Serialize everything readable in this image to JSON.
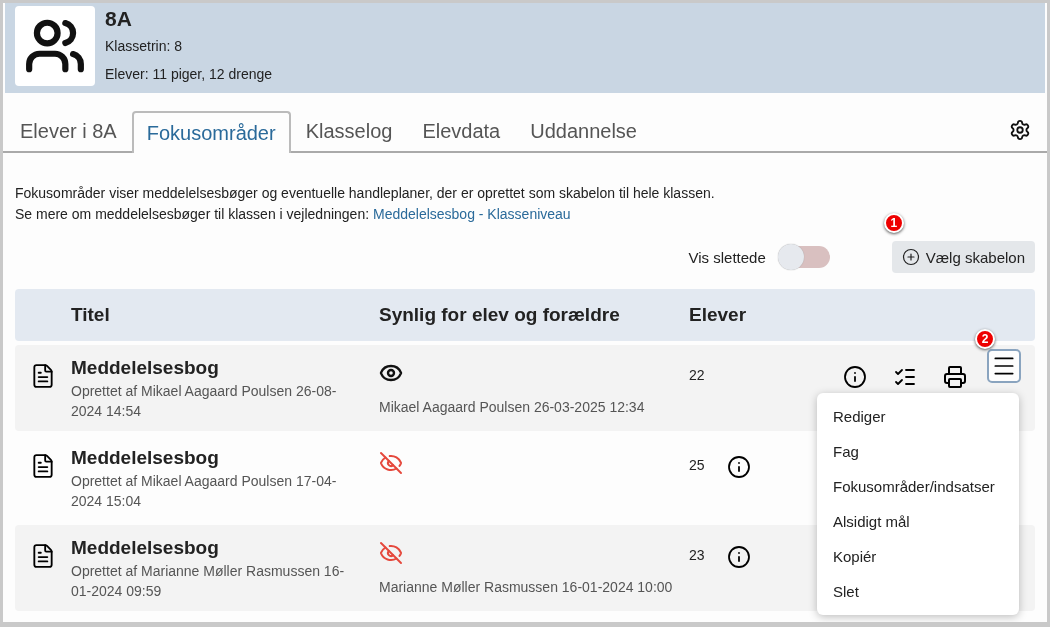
{
  "class_header": {
    "name": "8A",
    "grade": "Klassetrin: 8",
    "students": "Elever: 11 piger, 12 drenge"
  },
  "tabs": [
    {
      "label": "Elever i 8A",
      "selected": false
    },
    {
      "label": "Fokusområder",
      "selected": true
    },
    {
      "label": "Klasselog",
      "selected": false
    },
    {
      "label": "Elevdata",
      "selected": false
    },
    {
      "label": "Uddannelse",
      "selected": false
    }
  ],
  "intro": {
    "text": "Fokusområder viser meddelelsesbøger og eventuelle handleplaner, der er oprettet som skabelon til hele klassen.",
    "guide_text": "Se mere om meddelelsesbøger til klassen i vejledningen:",
    "guide_link": "Meddelelsesbog - Klasseniveau"
  },
  "show_deleted": {
    "label": "Vis slettede",
    "on": false
  },
  "template_button": {
    "label": "Vælg skabelon",
    "badge": "1"
  },
  "table": {
    "columns": [
      "Titel",
      "Synlig for elev og forældre",
      "Elever"
    ],
    "rows": [
      {
        "title": "Meddelelsesbog",
        "created": "Oprettet af Mikael Aagaard Poulsen 26-08-2024 14:54",
        "visible": true,
        "visibility_note": "Mikael Aagaard Poulsen 26-03-2025 12:34",
        "count": "22",
        "full_actions": true,
        "menu_badge": "2"
      },
      {
        "title": "Meddelelsesbog",
        "created": "Oprettet af Mikael Aagaard Poulsen 17-04-2024 15:04",
        "visible": false,
        "count": "25",
        "full_actions": false
      },
      {
        "title": "Meddelelsesbog",
        "created": "Oprettet af Marianne Møller Rasmussen 16-01-2024 09:59",
        "visible": false,
        "visibility_note": "Marianne Møller Rasmussen 16-01-2024 10:00",
        "count": "23",
        "full_actions": false
      }
    ]
  },
  "menu": {
    "items": [
      "Rediger",
      "Fag",
      "Fokusområder/indsatser",
      "Alsidigt mål",
      "Kopiér",
      "Slet"
    ]
  }
}
